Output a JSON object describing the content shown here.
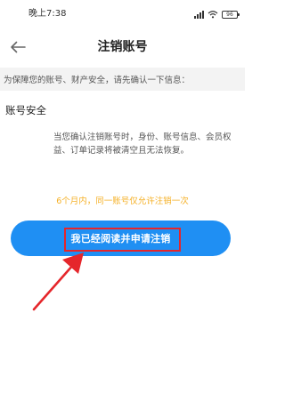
{
  "status_bar": {
    "time": "晚上7:38",
    "battery_level": "96"
  },
  "header": {
    "title": "注销账号"
  },
  "notice": {
    "text": "为保障您的账号、财产安全，请先确认一下信息："
  },
  "section": {
    "title": "账号安全",
    "description": "当您确认注销账号时，身份、账号信息、会员权益、订单记录将被清空且无法恢复。"
  },
  "limit_note": "6个月内，同一账号仅允许注销一次",
  "confirm_button": {
    "label": "我已经阅读并申请注销"
  },
  "colors": {
    "primary": "#1f8ff3",
    "accent": "#f5b128",
    "annotation": "#e5262b"
  },
  "icons": [
    "signal-icon",
    "wifi-icon",
    "battery-icon",
    "back-arrow-icon",
    "annotation-arrow-icon"
  ]
}
